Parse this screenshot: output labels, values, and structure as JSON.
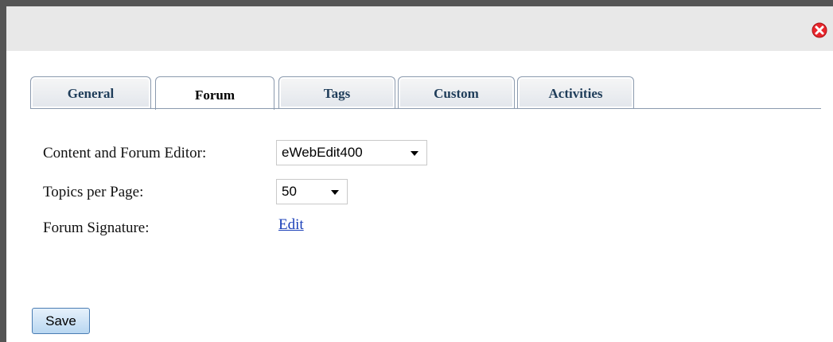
{
  "tabs": [
    {
      "label": "General",
      "active": false
    },
    {
      "label": "Forum",
      "active": true
    },
    {
      "label": "Tags",
      "active": false
    },
    {
      "label": "Custom",
      "active": false
    },
    {
      "label": "Activities",
      "active": false
    }
  ],
  "form": {
    "editor_label": "Content and Forum Editor:",
    "editor_value": "eWebEdit400",
    "topics_label": "Topics per Page:",
    "topics_value": "50",
    "signature_label": "Forum Signature:",
    "signature_link": "Edit"
  },
  "buttons": {
    "save_label": "Save"
  },
  "icons": {
    "close": "close-icon"
  },
  "colors": {
    "close_red": "#e8262c",
    "link_blue": "#1a3fb8",
    "tab_text": "#1f3d5a"
  }
}
